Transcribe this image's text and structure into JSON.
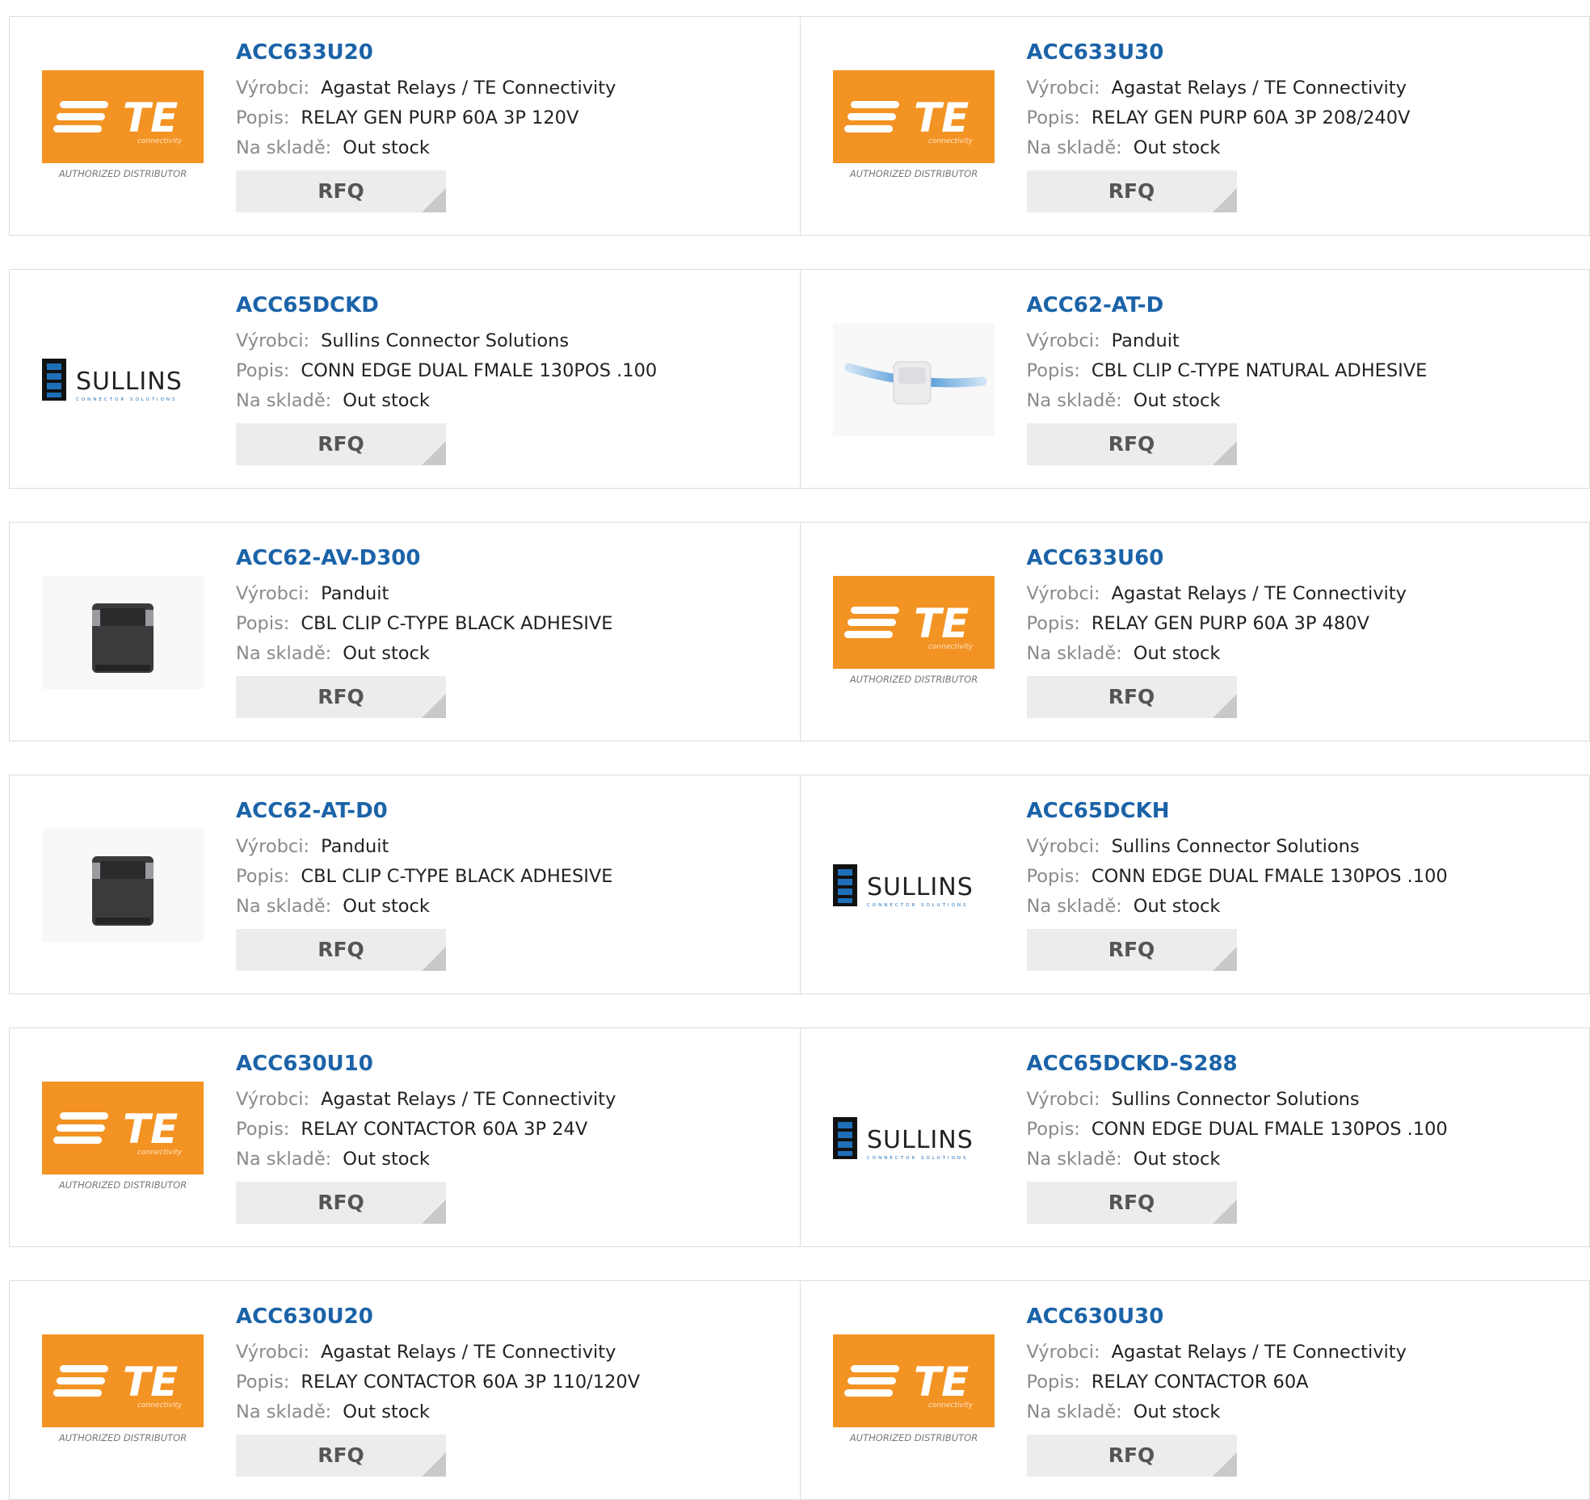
{
  "labels": {
    "manufacturer": "Výrobci:",
    "description": "Popis:",
    "stock": "Na skladě:"
  },
  "logos": {
    "te": {
      "brand": "TE",
      "tagline": "connectivity",
      "caption": "AUTHORIZED DISTRIBUTOR",
      "color": "#f39323"
    },
    "sullins": {
      "brand": "SULLINS",
      "tagline": "CONNECTOR SOLUTIONS",
      "color": "#1e6fb8"
    }
  },
  "products": [
    [
      {
        "part": "ACC633U20",
        "manufacturer": "Agastat Relays / TE Connectivity",
        "description": "RELAY GEN PURP 60A 3P 120V",
        "stock": "Out stock",
        "rfq": "RFQ",
        "logo": "te-logo"
      },
      {
        "part": "ACC633U30",
        "manufacturer": "Agastat Relays / TE Connectivity",
        "description": "RELAY GEN PURP 60A 3P 208/240V",
        "stock": "Out stock",
        "rfq": "RFQ",
        "logo": "te-logo"
      }
    ],
    [
      {
        "part": "ACC65DCKD",
        "manufacturer": "Sullins Connector Solutions",
        "description": "CONN EDGE DUAL FMALE 130POS .100",
        "stock": "Out stock",
        "rfq": "RFQ",
        "logo": "sullins-logo"
      },
      {
        "part": "ACC62-AT-D",
        "manufacturer": "Panduit",
        "description": "CBL CLIP C-TYPE NATURAL ADHESIVE",
        "stock": "Out stock",
        "rfq": "RFQ",
        "logo": "white-cable-clip-image"
      }
    ],
    [
      {
        "part": "ACC62-AV-D300",
        "manufacturer": "Panduit",
        "description": "CBL CLIP C-TYPE BLACK ADHESIVE",
        "stock": "Out stock",
        "rfq": "RFQ",
        "logo": "black-cable-clip-image"
      },
      {
        "part": "ACC633U60",
        "manufacturer": "Agastat Relays / TE Connectivity",
        "description": "RELAY GEN PURP 60A 3P 480V",
        "stock": "Out stock",
        "rfq": "RFQ",
        "logo": "te-logo"
      }
    ],
    [
      {
        "part": "ACC62-AT-D0",
        "manufacturer": "Panduit",
        "description": "CBL CLIP C-TYPE BLACK ADHESIVE",
        "stock": "Out stock",
        "rfq": "RFQ",
        "logo": "black-cable-clip-image"
      },
      {
        "part": "ACC65DCKH",
        "manufacturer": "Sullins Connector Solutions",
        "description": "CONN EDGE DUAL FMALE 130POS .100",
        "stock": "Out stock",
        "rfq": "RFQ",
        "logo": "sullins-logo"
      }
    ],
    [
      {
        "part": "ACC630U10",
        "manufacturer": "Agastat Relays / TE Connectivity",
        "description": "RELAY CONTACTOR 60A 3P 24V",
        "stock": "Out stock",
        "rfq": "RFQ",
        "logo": "te-logo"
      },
      {
        "part": "ACC65DCKD-S288",
        "manufacturer": "Sullins Connector Solutions",
        "description": "CONN EDGE DUAL FMALE 130POS .100",
        "stock": "Out stock",
        "rfq": "RFQ",
        "logo": "sullins-logo"
      }
    ],
    [
      {
        "part": "ACC630U20",
        "manufacturer": "Agastat Relays / TE Connectivity",
        "description": "RELAY CONTACTOR 60A 3P 110/120V",
        "stock": "Out stock",
        "rfq": "RFQ",
        "logo": "te-logo"
      },
      {
        "part": "ACC630U30",
        "manufacturer": "Agastat Relays / TE Connectivity",
        "description": "RELAY CONTACTOR 60A",
        "stock": "Out stock",
        "rfq": "RFQ",
        "logo": "te-logo"
      }
    ]
  ]
}
